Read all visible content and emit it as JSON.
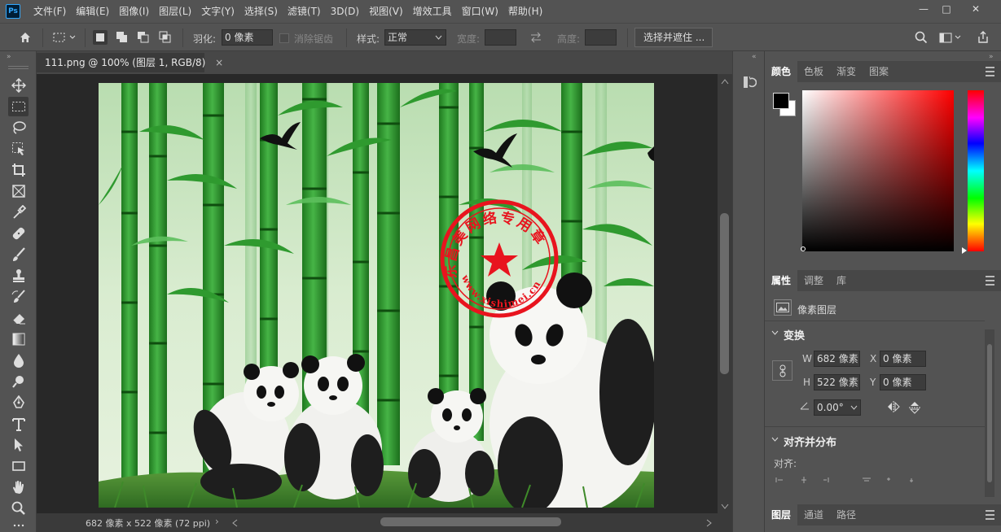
{
  "app": {
    "logo": "Ps"
  },
  "menu": [
    "文件(F)",
    "编辑(E)",
    "图像(I)",
    "图层(L)",
    "文字(Y)",
    "选择(S)",
    "滤镜(T)",
    "3D(D)",
    "视图(V)",
    "增效工具",
    "窗口(W)",
    "帮助(H)"
  ],
  "window_controls": {
    "minimize": "—",
    "restore": "□",
    "close": "✕"
  },
  "options": {
    "feather_label": "羽化:",
    "feather_value": "0 像素",
    "antialias_label": "消除锯齿",
    "style_label": "样式:",
    "style_value": "正常",
    "width_label": "宽度:",
    "height_label": "高度:",
    "select_mask_button": "选择并遮住 ..."
  },
  "document": {
    "tab_title": "111.png @ 100% (图层 1, RGB/8)",
    "tab_close": "×",
    "status_text": "682 像素 x 522 像素 (72 ppi)",
    "status_arrow": "›",
    "stamp_text": "东昌美网络专用章",
    "stamp_url": "www.xishimei.cn"
  },
  "color_panel": {
    "tabs": [
      "颜色",
      "色板",
      "渐变",
      "图案"
    ],
    "foreground": "#000000",
    "background": "#ffffff",
    "hue": "#ff0000"
  },
  "properties_panel": {
    "tabs": [
      "属性",
      "调整",
      "库"
    ],
    "layer_type": "像素图层",
    "transform_title": "变换",
    "w_label": "W",
    "w_value": "682 像素",
    "h_label": "H",
    "h_value": "522 像素",
    "x_label": "X",
    "x_value": "0 像素",
    "y_label": "Y",
    "y_value": "0 像素",
    "angle_value": "0.00°",
    "align_title": "对齐并分布",
    "align_label": "对齐:"
  },
  "layers_panel": {
    "tabs": [
      "图层",
      "通道",
      "路径"
    ]
  },
  "tools": [
    "move-tool",
    "marquee-tool",
    "lasso-tool",
    "object-select-tool",
    "crop-tool",
    "frame-tool",
    "eyedropper-tool",
    "healing-tool",
    "brush-tool",
    "stamp-tool",
    "history-brush-tool",
    "eraser-tool",
    "gradient-tool",
    "blur-tool",
    "dodge-tool",
    "pen-tool",
    "type-tool",
    "path-select-tool",
    "shape-tool",
    "hand-tool",
    "zoom-tool"
  ]
}
